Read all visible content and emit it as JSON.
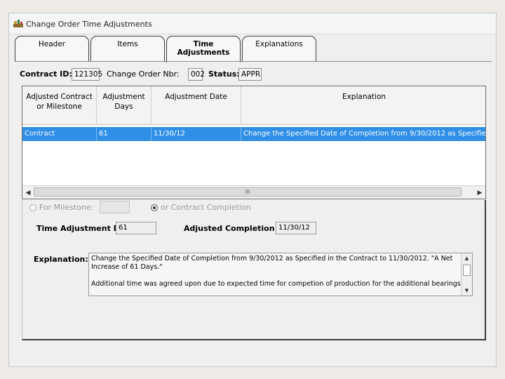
{
  "window": {
    "title": "Change Order Time Adjustments"
  },
  "tabs": [
    {
      "label": "Header"
    },
    {
      "label": "Items"
    },
    {
      "label": "Time Adjustments"
    },
    {
      "label": "Explanations"
    }
  ],
  "header": {
    "contract_id_label": "Contract ID:",
    "contract_id_value": "121305",
    "change_order_label": "Change Order Nbr:",
    "change_order_value": "002",
    "status_label": "Status:",
    "status_value": "APPR"
  },
  "grid": {
    "columns": [
      "Adjusted Contract or Milestone",
      "Adjustment Days",
      "Adjustment Date",
      "Explanation"
    ],
    "rows": [
      {
        "contract": "Contract",
        "days": "61",
        "date": "11/30/12",
        "explanation": "Change the Specified Date of Completion from 9/30/2012 as Specified in the Cont"
      }
    ],
    "scroll_thumb_text": "III"
  },
  "detail": {
    "for_milestone_label": "For Milestone:",
    "contract_completion_label": "or Contract Completion",
    "selected_option": "contract_completion",
    "time_adjustment_days_label": "Time Adjustment Days:",
    "time_adjustment_days_value": "61",
    "adjusted_completion_label": "Adjusted Completion Date:",
    "adjusted_completion_value": "11/30/12",
    "explanation_label": "Explanation:",
    "explanation_line1": "Change the Specified Date of Completion from 9/30/2012 as Specified in the Contract to 11/30/2012. \"A Net Increase of 61 Days.\"",
    "explanation_line2": "Additional time was agreed upon due to expected time for competion of production for the additional bearings. Milestone"
  },
  "colors": {
    "selection": "#2f8fe6",
    "window_bg": "#f0efee",
    "page_bg": "#eeebe7"
  }
}
